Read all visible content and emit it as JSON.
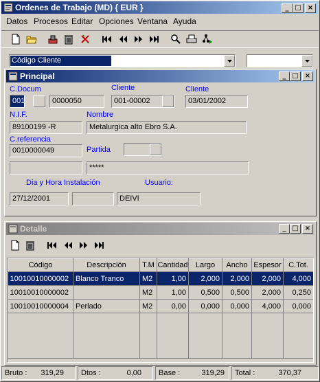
{
  "window": {
    "title": "Ordenes de Trabajo (MD) { EUR }"
  },
  "menu": [
    "Datos",
    "Procesos",
    "Editar",
    "Opciones",
    "Ventana",
    "Ayuda"
  ],
  "search": {
    "field_value": "Código Cliente",
    "second_value": ""
  },
  "principal": {
    "title": "Principal",
    "labels": {
      "cdocum": "C.Docum",
      "cliente1": "Cliente",
      "cliente2": "Cliente",
      "nif": "N.I.F.",
      "nombre": "Nombre",
      "creferencia": "C.referencia",
      "partida": "Partida",
      "dia_hora": "Dia y Hora Instalación",
      "usuario": "Usuario:"
    },
    "values": {
      "cdocum_code": "001",
      "cdocum_num": "0000050",
      "cliente_code": "001-00002",
      "fecha": "03/01/2002",
      "nif": "89100199 -R",
      "nombre": "Metalurgica alto Ebro S.A.",
      "creferencia": "0010000049",
      "partida": "",
      "ref_extra": "",
      "masked": "*****",
      "fecha_inst": "27/12/2001",
      "hora_inst": "",
      "usuario": "DEIVI"
    }
  },
  "detalle": {
    "title": "Detalle",
    "columns": [
      "Código",
      "Descripción",
      "T.M",
      "Cantidad",
      "Largo",
      "Ancho",
      "Espesor",
      "C.Tot."
    ],
    "rows": [
      [
        "10010010000002",
        "Blanco Tranco",
        "M2",
        "1,00",
        "2,000",
        "2,000",
        "2,000",
        "4,000"
      ],
      [
        "10010010000002",
        "",
        "M2",
        "1,00",
        "0,500",
        "0,500",
        "2,000",
        "0,250"
      ],
      [
        "10010010000004",
        "Perlado",
        "M2",
        "0,00",
        "0,000",
        "0,000",
        "4,000",
        "0,000"
      ]
    ]
  },
  "status": {
    "bruto_label": "Bruto :",
    "bruto_value": "319,29",
    "dtos_label": "Dtos :",
    "dtos_value": "0,00",
    "base_label": "Base :",
    "base_value": "319,29",
    "total_label": "Total :",
    "total_value": "370,37"
  }
}
